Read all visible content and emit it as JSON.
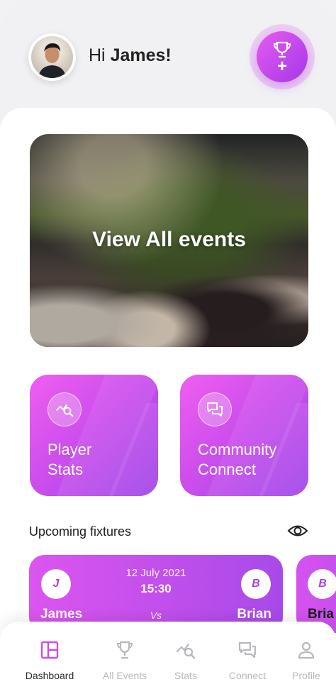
{
  "header": {
    "greeting_prefix": "Hi ",
    "user_name": "James!",
    "add_event_plus": "+"
  },
  "hero": {
    "title": "View All events"
  },
  "tiles": [
    {
      "line1": "Player",
      "line2": "Stats",
      "icon": "stats-search-icon"
    },
    {
      "line1": "Community",
      "line2": "Connect",
      "icon": "chat-bubbles-icon"
    }
  ],
  "fixtures": {
    "title": "Upcoming fixtures",
    "items": [
      {
        "date": "12 July 2021",
        "time": "15:30",
        "home_initial": "J",
        "home_name": "James",
        "vs": "Vs",
        "away_initial": "B",
        "away_name": "Brian"
      },
      {
        "away_initial": "B",
        "away_name": "Bria"
      }
    ]
  },
  "nav": {
    "items": [
      {
        "label": "Dashboard",
        "icon": "dashboard-icon",
        "active": true
      },
      {
        "label": "All Events",
        "icon": "trophy-icon",
        "active": false
      },
      {
        "label": "Stats",
        "icon": "stats-search-icon",
        "active": false
      },
      {
        "label": "Connect",
        "icon": "chat-bubbles-icon",
        "active": false
      },
      {
        "label": "Profile",
        "icon": "person-icon",
        "active": false
      }
    ]
  },
  "colors": {
    "accent_pink": "#ef5ff0",
    "accent_purple": "#9f45e9",
    "nav_active": "#c94eec",
    "nav_inactive": "#b7b7bd"
  }
}
